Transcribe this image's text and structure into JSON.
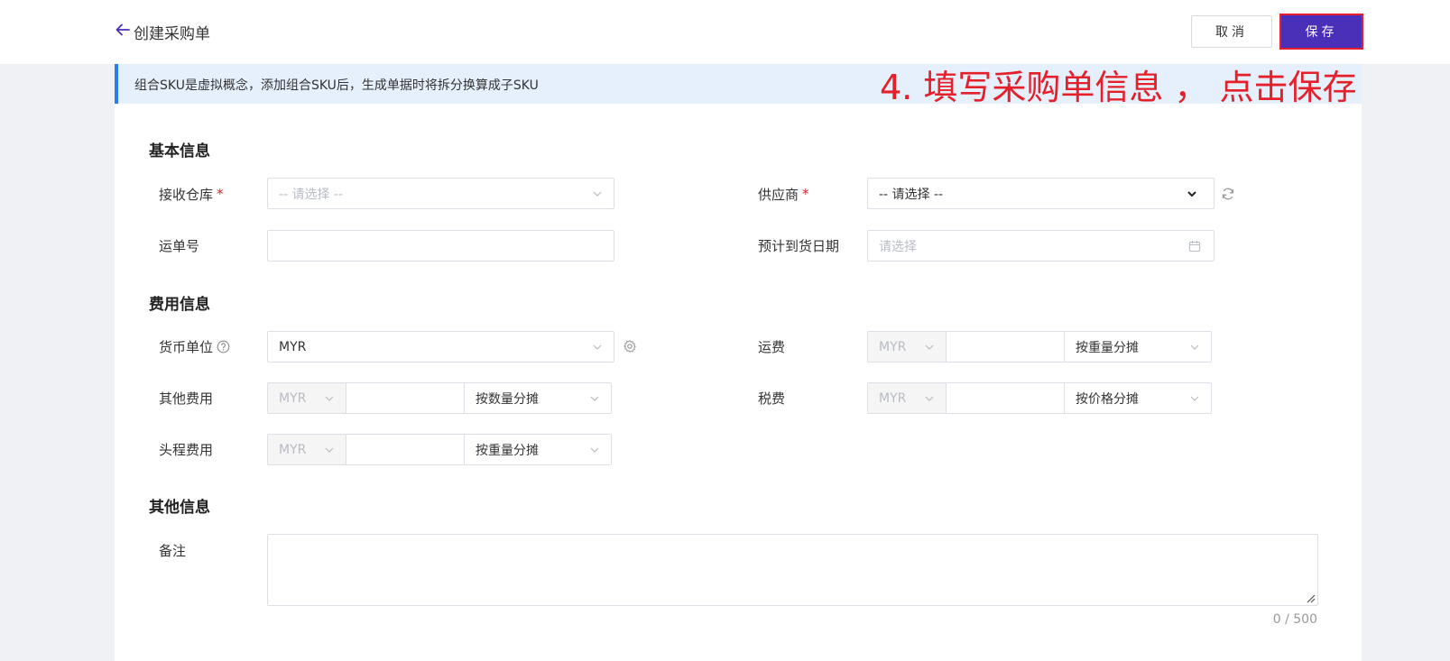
{
  "header": {
    "title": "创建采购单",
    "cancel_label": "取消",
    "save_label": "保存"
  },
  "notice": {
    "text": "组合SKU是虚拟概念，添加组合SKU后，生成单据时将拆分换算成子SKU"
  },
  "annotation": {
    "text": "4. 填写采购单信息 ， 点击保存"
  },
  "sections": {
    "basic": "基本信息",
    "fees": "费用信息",
    "other": "其他信息"
  },
  "basic": {
    "warehouse_label": "接收仓库",
    "warehouse_placeholder": "-- 请选择 --",
    "supplier_label": "供应商",
    "supplier_value": "-- 请选择 --",
    "waybill_label": "运单号",
    "waybill_value": "",
    "eta_label": "预计到货日期",
    "eta_placeholder": "请选择",
    "required_mark": "*"
  },
  "fees": {
    "currency_label": "货币单位",
    "currency_value": "MYR",
    "freight_label": "运费",
    "freight_currency": "MYR",
    "freight_alloc": "按重量分摊",
    "other_label": "其他费用",
    "other_currency": "MYR",
    "other_alloc": "按数量分摊",
    "tax_label": "税费",
    "tax_currency": "MYR",
    "tax_alloc": "按价格分摊",
    "firstleg_label": "头程费用",
    "firstleg_currency": "MYR",
    "firstleg_alloc": "按重量分摊"
  },
  "other": {
    "remark_label": "备注",
    "remark_value": "",
    "counter": "0 / 500"
  },
  "colors": {
    "primary": "#4a2fb8",
    "annotation_red": "#e4202a",
    "notice_bg": "#e6f0fd",
    "notice_bar": "#2b7cf0"
  },
  "icons": {
    "back": "arrow-left-icon",
    "chevron": "chevron-down-icon",
    "refresh": "refresh-icon",
    "calendar": "calendar-icon",
    "help": "question-circle-icon",
    "settings": "gear-icon"
  }
}
